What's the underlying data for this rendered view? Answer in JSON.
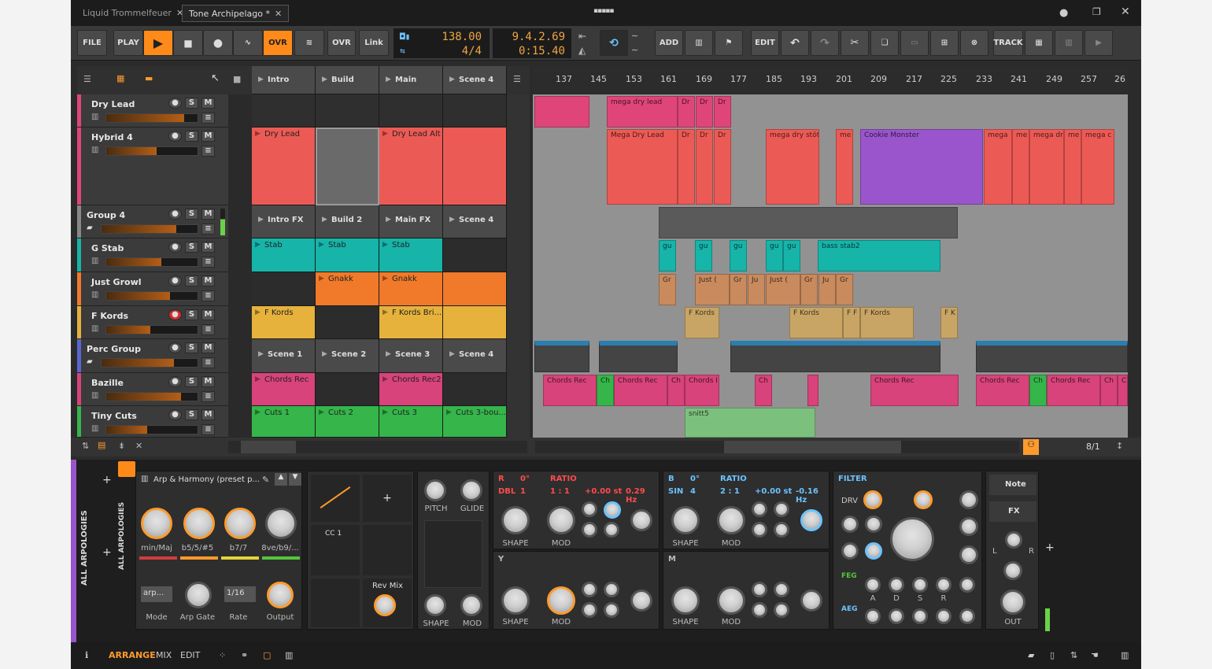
{
  "titlebar": {
    "tabs": [
      {
        "label": "Liquid Trommelfeuer"
      },
      {
        "label": "Tone Archipelago *"
      }
    ]
  },
  "transport": {
    "file": "FILE",
    "play": "PLAY",
    "ovr": "OVR",
    "ovr2": "OVR",
    "link": "Link",
    "tempo": "138.00",
    "time_sig": "4/4",
    "position": "9.4.2.69",
    "time": "0:15.40",
    "add": "ADD",
    "edit": "EDIT",
    "track": "TRACK"
  },
  "launcher": {
    "scenes": [
      "Intro",
      "Build",
      "Main",
      "Scene 4"
    ],
    "tracks": [
      {
        "name": "Dry Lead",
        "color": "#e0457a"
      },
      {
        "name": "Hybrid 4",
        "color": "#e0457a"
      },
      {
        "name": "Group 4",
        "color": "#888888"
      },
      {
        "name": "G Stab",
        "color": "#16b4a9"
      },
      {
        "name": "Just Growl",
        "color": "#f07a2a"
      },
      {
        "name": "F Kords",
        "color": "#e6b23c"
      },
      {
        "name": "Perc Group",
        "color": "#5a66d0"
      },
      {
        "name": "Bazille",
        "color": "#d7437a"
      },
      {
        "name": "Tiny Cuts",
        "color": "#35b54a"
      }
    ],
    "clips": {
      "dry_lead": [
        "Dry Lead",
        "Dry Lead Alt"
      ],
      "group4": [
        "Intro FX",
        "Build 2",
        "Main FX",
        "Scene 4"
      ],
      "gstab": [
        "Stab",
        "Stab",
        "Stab"
      ],
      "growl": [
        "Gnakk",
        "Gnakk"
      ],
      "fkords": [
        "F Kords",
        "F Kords Bri..."
      ],
      "perc": [
        "Scene 1",
        "Scene 2",
        "Scene 3",
        "Scene 4"
      ],
      "bazille": [
        "Chords Rec",
        "Chords Rec2"
      ],
      "cuts": [
        "Cuts 1",
        "Cuts 2",
        "Cuts 3",
        "Cuts 3-bou..."
      ]
    }
  },
  "arranger": {
    "ruler": [
      "137",
      "145",
      "153",
      "161",
      "169",
      "177",
      "185",
      "193",
      "201",
      "209",
      "217",
      "225",
      "233",
      "241",
      "249",
      "257",
      "26"
    ],
    "clips": {
      "mega_dry_lead": "mega dry lead",
      "dr": "Dr",
      "mega_dry_lead2": "Mega Dry Lead",
      "mega_dry_stot": "mega dry stöt",
      "me": "me",
      "cookie": "Cookie Monster",
      "mega": "mega",
      "mega_dr": "mega dr",
      "mega_c": "mega c",
      "gu": "gu",
      "bass_stab2": "bass stab2",
      "gr": "Gr",
      "ju": "Ju",
      "just": "Just (",
      "f_kords": "F Kords",
      "f_k": "F K",
      "f_f": "F F",
      "chords_rec": "Chords Rec",
      "ch": "Ch",
      "chords_i": "Chords I",
      "c": "C",
      "snitt5": "snitt5"
    },
    "zoom": "8/1"
  },
  "devices": {
    "side_label_1": "ALL ARPOLOGIES",
    "side_label_2": "ALL ARPOLOGIES",
    "preset": "Arp & Harmony (preset p...",
    "arp_labels": [
      "min/Maj",
      "b5/5/#5",
      "b7/7",
      "8ve/b9/..."
    ],
    "arp_bottom": [
      "Mode",
      "Arp Gate",
      "Rate",
      "Output"
    ],
    "arp_mode_value": "arp...",
    "arp_rate_value": "1/16",
    "cc1": "CC 1",
    "rev_mix": "Rev Mix",
    "pitch": "PITCH",
    "glide": "GLIDE",
    "shape": "SHAPE",
    "mod": "MOD",
    "osc_r": {
      "letter": "R",
      "deg": "0°",
      "ratio": "RATIO",
      "wave": "DBL",
      "num": "1",
      "ratio_val": "1 : 1",
      "st": "+0.00 st",
      "hz": "0.29 Hz"
    },
    "osc_b": {
      "letter": "B",
      "deg": "0°",
      "ratio": "RATIO",
      "wave": "SIN",
      "num": "4",
      "ratio_val": "2 : 1",
      "st": "+0.00 st",
      "hz": "-0.16 Hz"
    },
    "y": "Y",
    "m": "M",
    "filter": "FILTER",
    "drv": "DRV",
    "feg": "FEG",
    "aeg": "AEG",
    "adsr": [
      "A",
      "D",
      "S",
      "R"
    ],
    "note": "Note",
    "fx": "FX",
    "l": "L",
    "r": "R",
    "out": "OUT"
  },
  "footer": {
    "arrange": "ARRANGE",
    "mix": "MIX",
    "edit": "EDIT"
  }
}
